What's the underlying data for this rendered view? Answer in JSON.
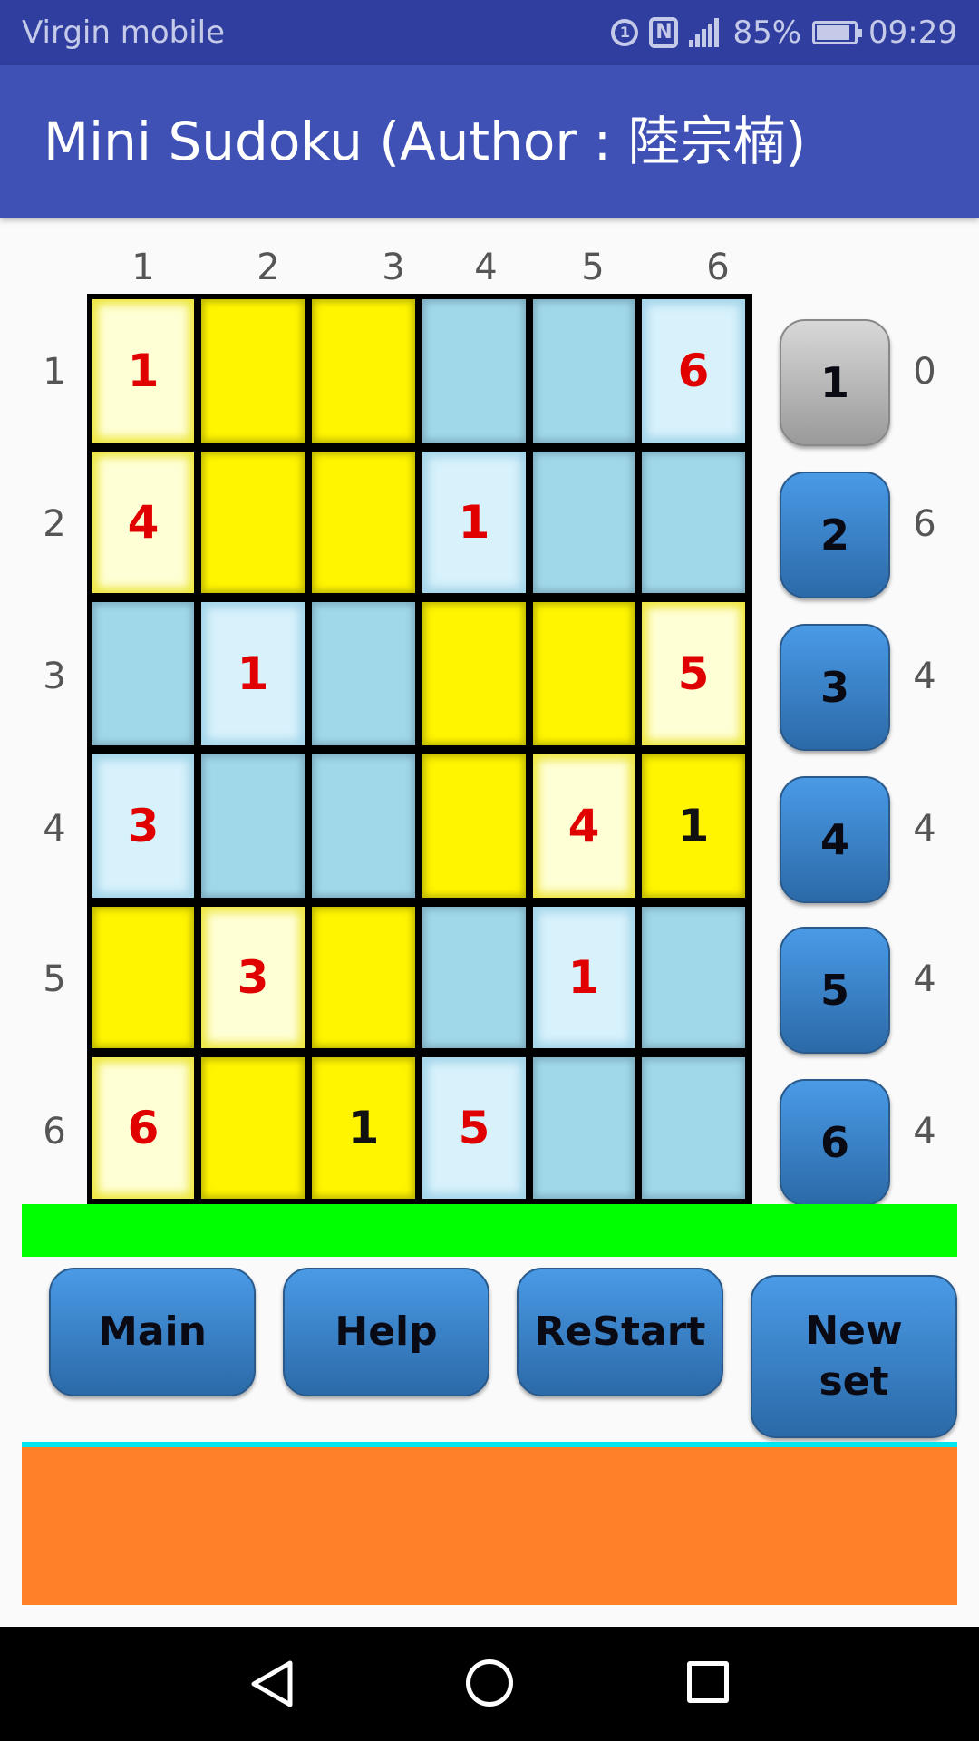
{
  "status_bar": {
    "carrier": "Virgin mobile",
    "icon_circle_text": "1",
    "icon_nfc_text": "N",
    "battery": "85%",
    "time": "09:29"
  },
  "app_bar": {
    "title": "Mini Sudoku (Author : 陸宗楠)"
  },
  "board": {
    "col_labels": [
      "1",
      "2",
      "3",
      "4",
      "5",
      "6"
    ],
    "row_labels": [
      "1",
      "2",
      "3",
      "4",
      "5",
      "6"
    ],
    "colors": {
      "yellow": "#fff500",
      "blue": "#a0d8ea",
      "given_text": "#e00000",
      "entered_text": "#111111"
    },
    "rows": [
      [
        {
          "c": "ly",
          "v": "1",
          "t": "given"
        },
        {
          "c": "yellow",
          "v": ""
        },
        {
          "c": "yellow",
          "v": ""
        },
        {
          "c": "blue",
          "v": ""
        },
        {
          "c": "blue",
          "v": ""
        },
        {
          "c": "lb",
          "v": "6",
          "t": "given"
        }
      ],
      [
        {
          "c": "ly",
          "v": "4",
          "t": "given"
        },
        {
          "c": "yellow",
          "v": ""
        },
        {
          "c": "yellow",
          "v": ""
        },
        {
          "c": "lb",
          "v": "1",
          "t": "given"
        },
        {
          "c": "blue",
          "v": ""
        },
        {
          "c": "blue",
          "v": ""
        }
      ],
      [
        {
          "c": "blue",
          "v": ""
        },
        {
          "c": "lb",
          "v": "1",
          "t": "given"
        },
        {
          "c": "blue",
          "v": ""
        },
        {
          "c": "yellow",
          "v": ""
        },
        {
          "c": "yellow",
          "v": ""
        },
        {
          "c": "ly",
          "v": "5",
          "t": "given"
        }
      ],
      [
        {
          "c": "lb",
          "v": "3",
          "t": "given"
        },
        {
          "c": "blue",
          "v": ""
        },
        {
          "c": "blue",
          "v": ""
        },
        {
          "c": "yellow",
          "v": ""
        },
        {
          "c": "ly",
          "v": "4",
          "t": "given"
        },
        {
          "c": "yellow",
          "v": "1",
          "t": "entered"
        }
      ],
      [
        {
          "c": "yellow",
          "v": ""
        },
        {
          "c": "ly",
          "v": "3",
          "t": "given"
        },
        {
          "c": "yellow",
          "v": ""
        },
        {
          "c": "blue",
          "v": ""
        },
        {
          "c": "lb",
          "v": "1",
          "t": "given"
        },
        {
          "c": "blue",
          "v": ""
        }
      ],
      [
        {
          "c": "ly",
          "v": "6",
          "t": "given"
        },
        {
          "c": "yellow",
          "v": ""
        },
        {
          "c": "yellow",
          "v": "1",
          "t": "entered"
        },
        {
          "c": "lb",
          "v": "5",
          "t": "given"
        },
        {
          "c": "blue",
          "v": ""
        },
        {
          "c": "blue",
          "v": ""
        }
      ]
    ]
  },
  "number_picker": {
    "selected": "1",
    "buttons": [
      {
        "label": "1",
        "count": "0"
      },
      {
        "label": "2",
        "count": "6"
      },
      {
        "label": "3",
        "count": "4"
      },
      {
        "label": "4",
        "count": "4"
      },
      {
        "label": "5",
        "count": "4"
      },
      {
        "label": "6",
        "count": "4"
      }
    ]
  },
  "actions": {
    "main": "Main",
    "help": "Help",
    "restart": "ReStart",
    "new_set": "New set"
  },
  "panels": {
    "green": "#00ff00",
    "cyan": "#00e5ee",
    "orange": "#ff8029"
  },
  "nav_bar": {
    "icons": [
      "back-icon",
      "home-icon",
      "recent-apps-icon"
    ]
  }
}
